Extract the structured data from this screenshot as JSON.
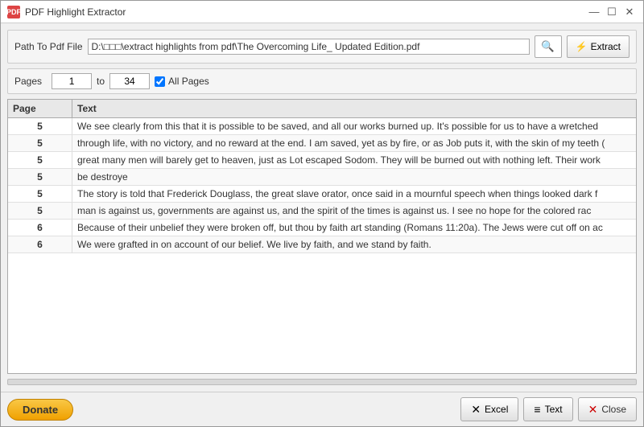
{
  "window": {
    "title": "PDF Highlight Extractor",
    "icon": "PDF"
  },
  "titlebar": {
    "minimize": "—",
    "maximize": "☐",
    "close": "✕"
  },
  "path_row": {
    "label": "Path To Pdf File",
    "value": "D:\\□□□\\extract highlights from pdf\\The Overcoming Life_ Updated Edition.pdf",
    "search_btn_label": "🔍",
    "extract_btn_label": "Extract"
  },
  "pages_row": {
    "label": "Pages",
    "from": "1",
    "to_label": "to",
    "to": "34",
    "all_pages_label": "All Pages"
  },
  "table": {
    "col_page": "Page",
    "col_text": "Text",
    "rows": [
      {
        "page": "5",
        "text": "We see clearly from this that it is possible to be saved, and all our works burned up. It's possible for us to have a wretched"
      },
      {
        "page": "5",
        "text": "through life, with no victory, and no reward at the end. I am saved, yet as by fire, or as Job puts it, with the skin of my teeth ("
      },
      {
        "page": "5",
        "text": "great many men will barely get to heaven, just as Lot escaped Sodom. They will be burned out with nothing left. Their work"
      },
      {
        "page": "5",
        "text": "be destroye"
      },
      {
        "page": "5",
        "text": "The story is told that Frederick Douglass, the great slave orator, once said in a mournful speech when things looked dark f"
      },
      {
        "page": "5",
        "text": "man is against us, governments are against us, and the spirit of the times is against us. I see no hope for the colored rac"
      },
      {
        "page": "6",
        "text": "Because of their unbelief they were broken off, but thou by faith art standing (Romans 11:20a). The Jews were cut off on ac"
      },
      {
        "page": "6",
        "text": "We were grafted in on account of our belief. We live by faith, and we stand by faith."
      }
    ]
  },
  "footer": {
    "donate_label": "Donate",
    "excel_label": "Excel",
    "text_label": "Text",
    "close_label": "Close"
  }
}
